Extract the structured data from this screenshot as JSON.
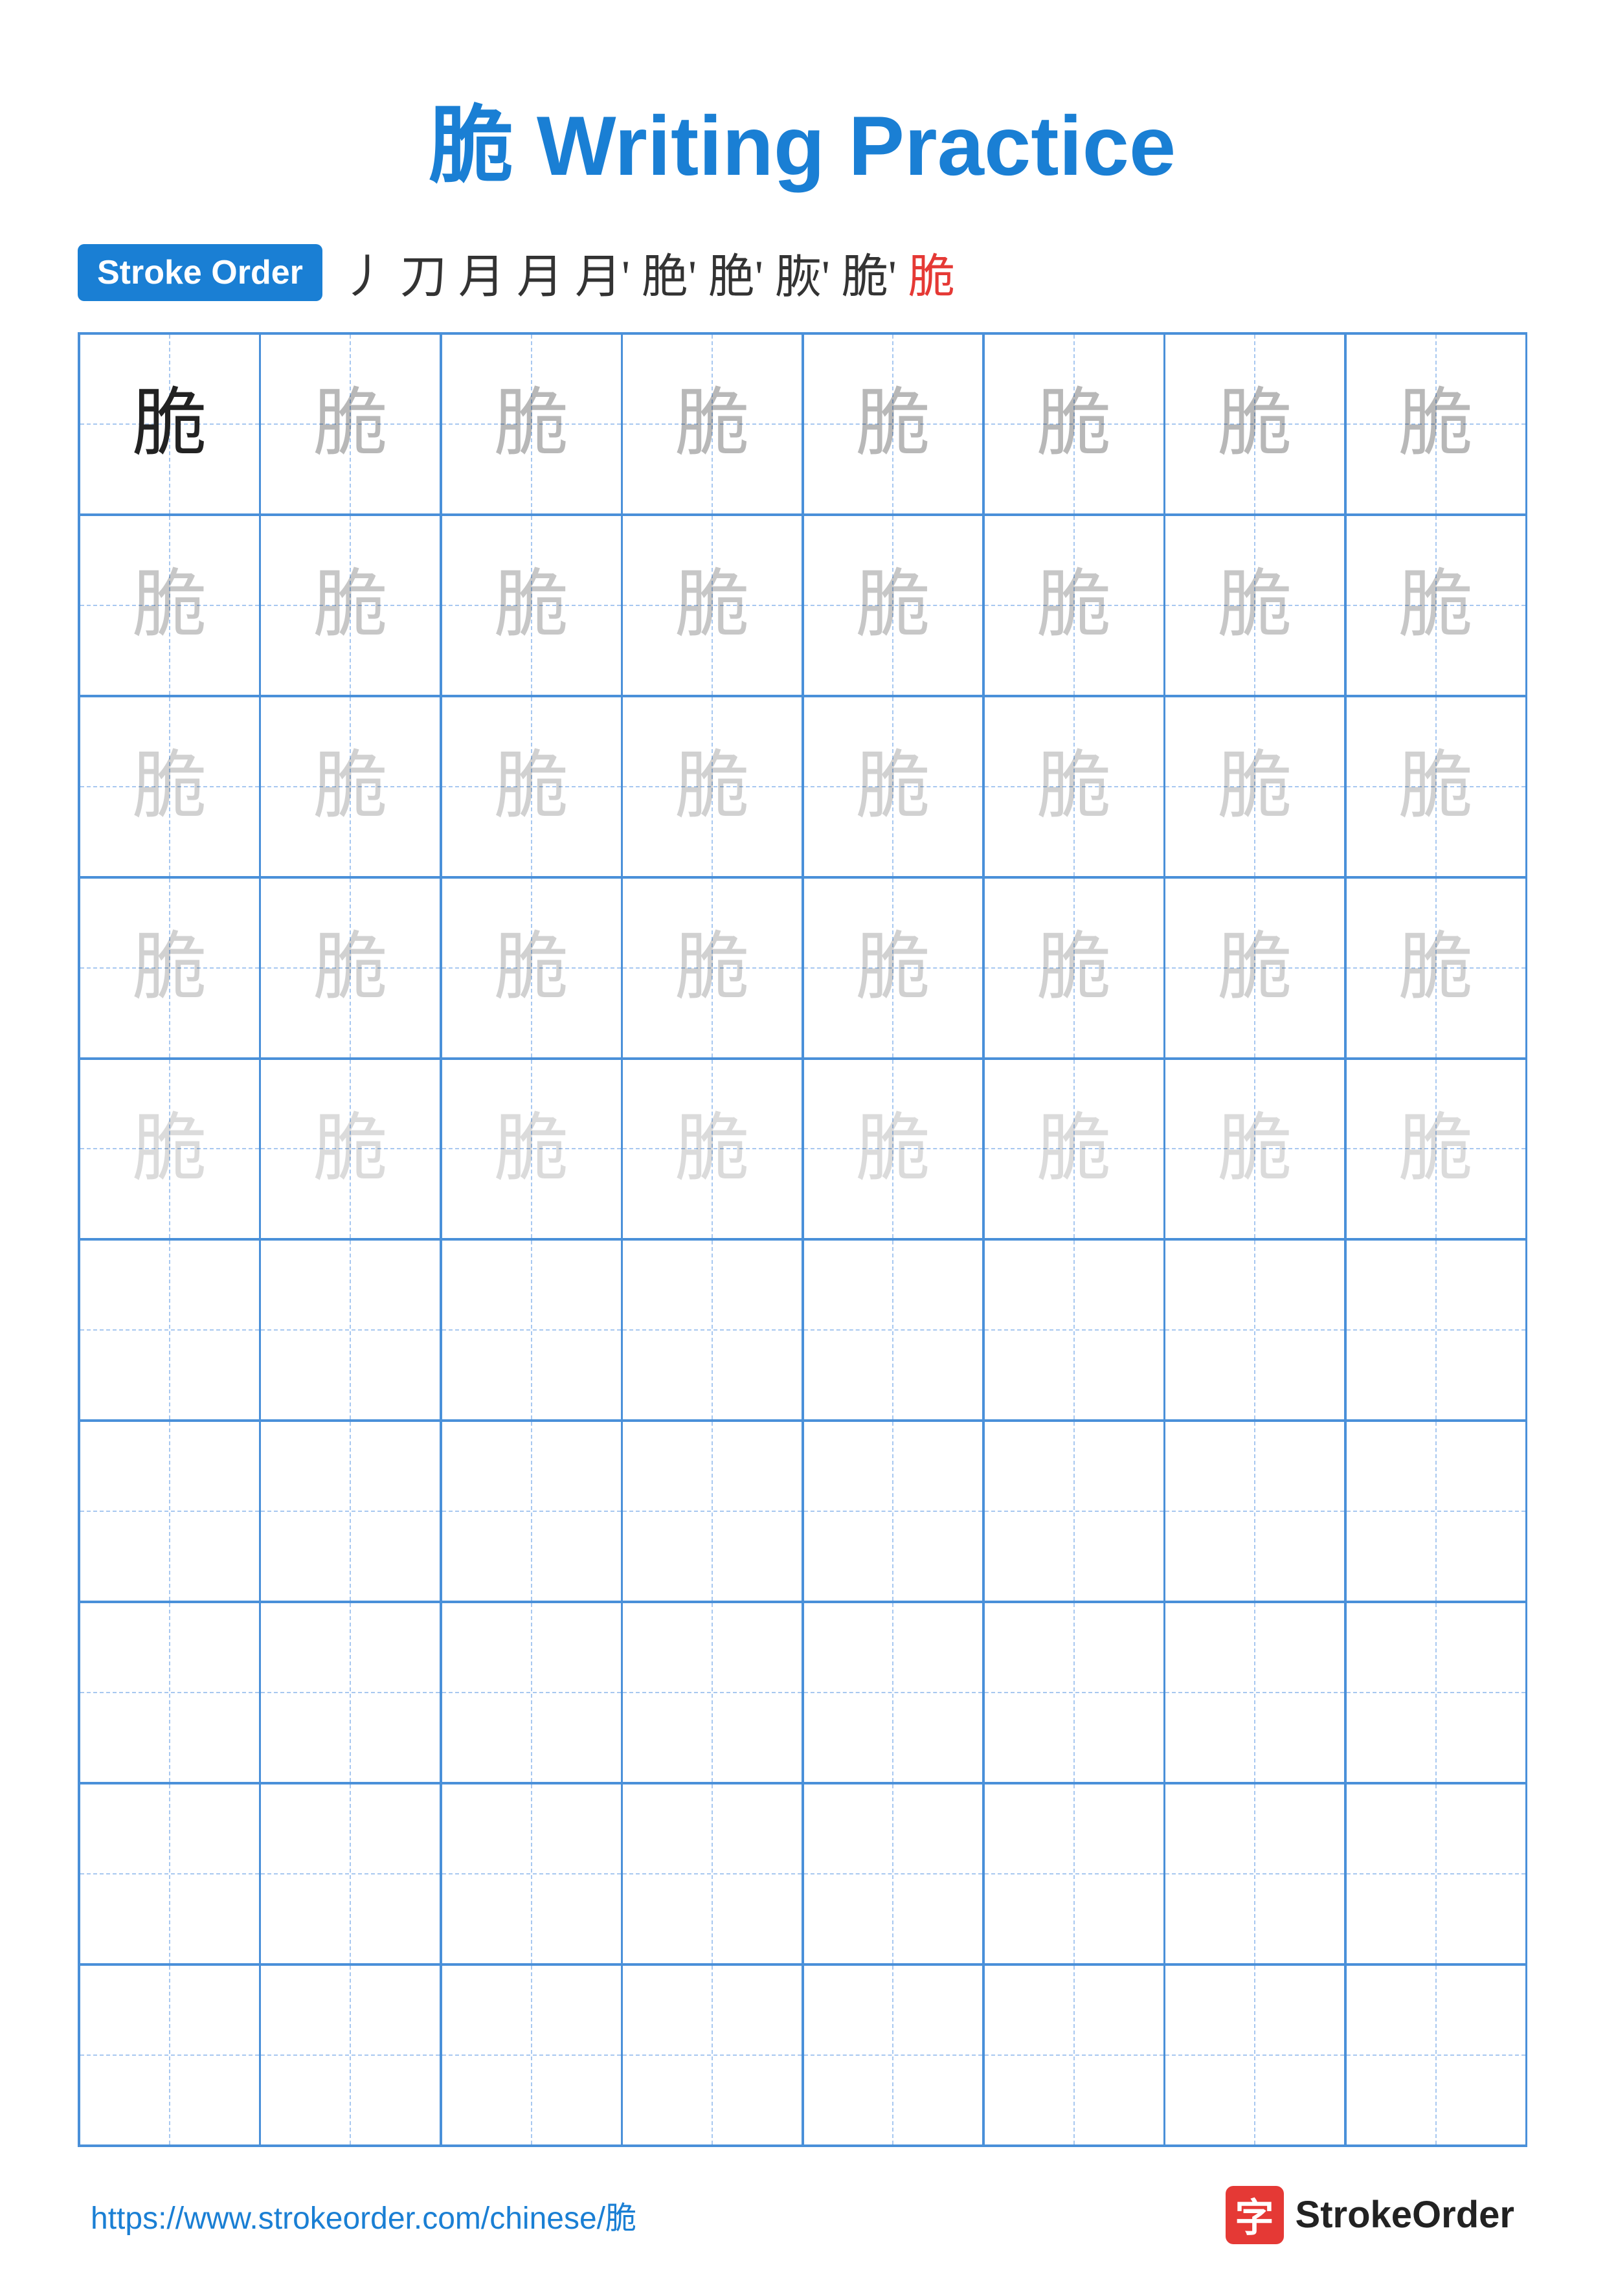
{
  "title": {
    "char": "脆",
    "rest": " Writing Practice"
  },
  "stroke_order": {
    "badge_label": "Stroke Order",
    "strokes": [
      "丿",
      "刀",
      "月",
      "月",
      "月'",
      "月'",
      "脆'",
      "脆'",
      "脆",
      "脆"
    ]
  },
  "grid": {
    "rows": 10,
    "cols": 8,
    "char": "脆",
    "practice_rows": 5,
    "empty_rows": 5
  },
  "footer": {
    "url": "https://www.strokeorder.com/chinese/脆",
    "logo_char": "字",
    "logo_text": "StrokeOrder"
  }
}
